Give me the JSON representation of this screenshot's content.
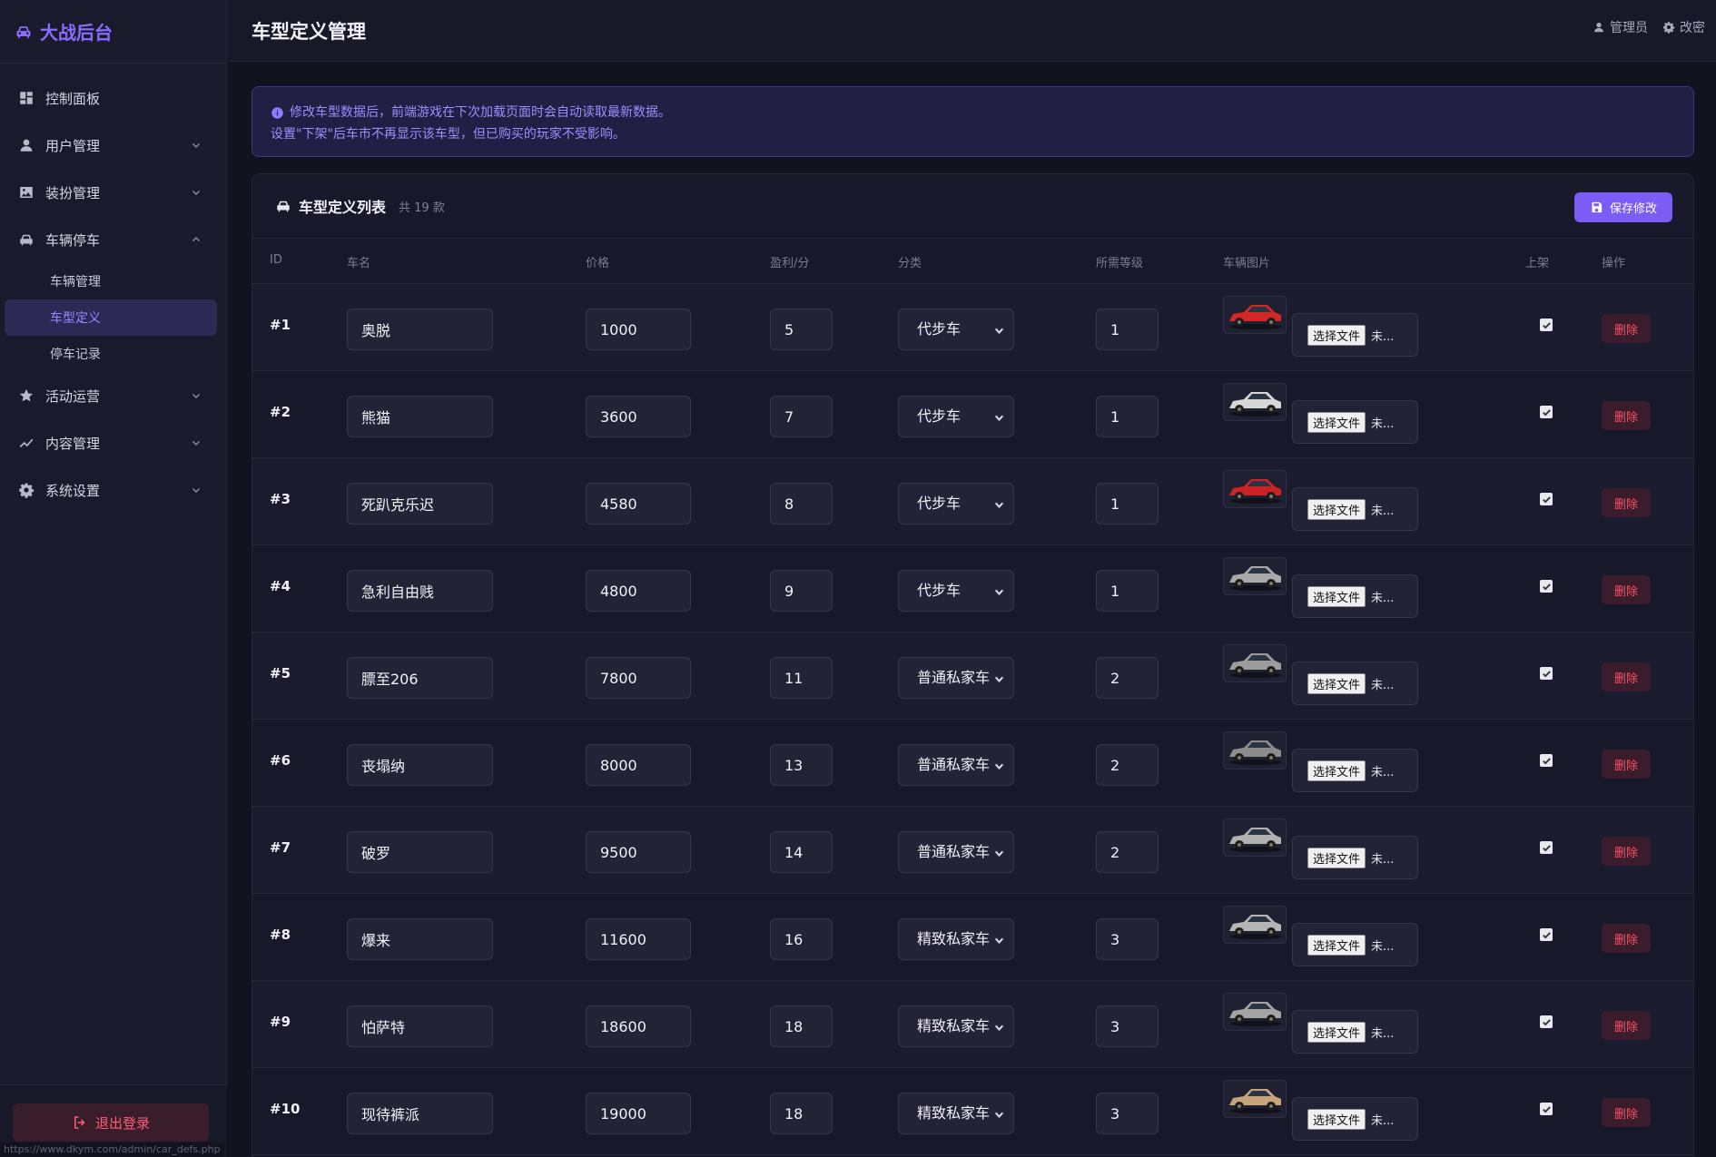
{
  "brand": {
    "title": "大战后台",
    "icon": "car-icon"
  },
  "sidebar": {
    "items": [
      {
        "key": "dashboard",
        "label": "控制面板",
        "icon": "dashboard-icon",
        "has_chevron": false
      },
      {
        "key": "users",
        "label": "用户管理",
        "icon": "user-icon",
        "has_chevron": true
      },
      {
        "key": "dress",
        "label": "装扮管理",
        "icon": "image-icon",
        "has_chevron": true
      },
      {
        "key": "parking",
        "label": "车辆停车",
        "icon": "car-icon",
        "has_chevron": true,
        "expanded": true
      }
    ],
    "sub_items": [
      {
        "label": "车辆管理",
        "active": false
      },
      {
        "label": "车型定义",
        "active": true
      },
      {
        "label": "停车记录",
        "active": false
      }
    ],
    "items_after": [
      {
        "key": "events",
        "label": "活动运营",
        "icon": "star-icon"
      },
      {
        "key": "content",
        "label": "内容管理",
        "icon": "chart-line-icon"
      },
      {
        "key": "settings",
        "label": "系统设置",
        "icon": "gear-icon"
      }
    ],
    "logout_label": "退出登录",
    "status_url": "https://www.dkym.com/admin/car_defs.php"
  },
  "header": {
    "title": "车型定义管理",
    "user_label": "管理员",
    "password_label": "改密"
  },
  "notice": {
    "line1": "修改车型数据后，前端游戏在下次加载页面时会自动读取最新数据。",
    "line2": "设置\"下架\"后车市不再显示该车型，但已购买的玩家不受影响。"
  },
  "card": {
    "title": "车型定义列表",
    "count": "共 19 款",
    "save_label": "保存修改"
  },
  "columns": [
    "ID",
    "车名",
    "价格",
    "盈利/分",
    "分类",
    "所需等级",
    "车辆图片",
    "上架",
    "操作"
  ],
  "rows": [
    {
      "id": "#1",
      "name": "奥脱",
      "price": "1000",
      "profit": "5",
      "category": "代步车",
      "level": "1",
      "car_color": "#d32727",
      "listed": true
    },
    {
      "id": "#2",
      "name": "熊猫",
      "price": "3600",
      "profit": "7",
      "category": "代步车",
      "level": "1",
      "car_color": "#d7d7d7",
      "listed": true
    },
    {
      "id": "#3",
      "name": "死趴克乐迟",
      "price": "4580",
      "profit": "8",
      "category": "代步车",
      "level": "1",
      "car_color": "#c92323",
      "listed": true
    },
    {
      "id": "#4",
      "name": "急利自由贱",
      "price": "4800",
      "profit": "9",
      "category": "代步车",
      "level": "1",
      "car_color": "#a9a9a9",
      "listed": true
    },
    {
      "id": "#5",
      "name": "膘至206",
      "price": "7800",
      "profit": "11",
      "category": "普通私家车",
      "level": "2",
      "car_color": "#9c9c9c",
      "listed": true
    },
    {
      "id": "#6",
      "name": "丧塌纳",
      "price": "8000",
      "profit": "13",
      "category": "普通私家车",
      "level": "2",
      "car_color": "#8c8c8c",
      "listed": true
    },
    {
      "id": "#7",
      "name": "破罗",
      "price": "9500",
      "profit": "14",
      "category": "普通私家车",
      "level": "2",
      "car_color": "#b0b0b0",
      "listed": true
    },
    {
      "id": "#8",
      "name": "爆来",
      "price": "11600",
      "profit": "16",
      "category": "精致私家车",
      "level": "3",
      "car_color": "#b5b5b5",
      "listed": true
    },
    {
      "id": "#9",
      "name": "怕萨特",
      "price": "18600",
      "profit": "18",
      "category": "精致私家车",
      "level": "3",
      "car_color": "#a4a4a4",
      "listed": true
    },
    {
      "id": "#10",
      "name": "现待裤派",
      "price": "19000",
      "profit": "18",
      "category": "精致私家车",
      "level": "3",
      "car_color": "#c8a47a",
      "listed": true
    }
  ],
  "file_input": {
    "button_label": "选择文件",
    "status": "未..."
  },
  "delete_label": "删除"
}
